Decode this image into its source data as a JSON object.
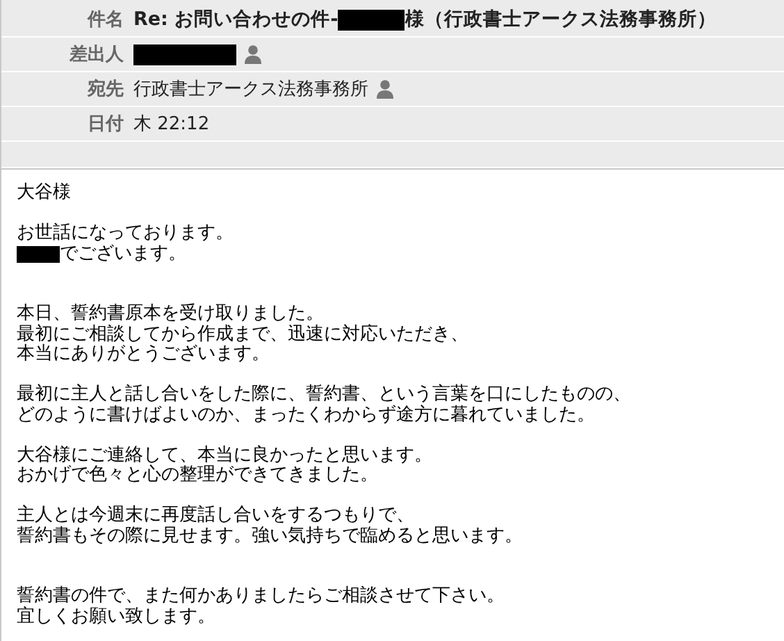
{
  "header": {
    "fields": [
      {
        "label": "件名",
        "kind": "subject",
        "parts": [
          {
            "text": "Re: お問い合わせの件-",
            "redacted_after": true
          },
          {
            "text": "様（行政書士アークス法務事務所）",
            "redacted_after": false
          }
        ],
        "contact_icon": false
      },
      {
        "label": "差出人",
        "kind": "plain",
        "parts": [
          {
            "redacted_after": true
          }
        ],
        "contact_icon": true
      },
      {
        "label": "宛先",
        "kind": "plain",
        "parts": [
          {
            "text": "行政書士アークス法務事務所",
            "redacted_after": false
          }
        ],
        "contact_icon": true
      },
      {
        "label": "日付",
        "kind": "plain",
        "parts": [
          {
            "text": "木 22:12",
            "redacted_after": false
          }
        ],
        "contact_icon": false
      }
    ]
  },
  "body": {
    "paragraphs": [
      {
        "wide_gap": false,
        "lines": [
          {
            "text": "大谷様",
            "redacted_before": false
          }
        ]
      },
      {
        "wide_gap": false,
        "lines": [
          {
            "text": "お世話になっております。",
            "redacted_before": false
          },
          {
            "text": "でございます。",
            "redacted_before": true
          }
        ]
      },
      {
        "wide_gap": true,
        "lines": [
          {
            "text": "本日、誓約書原本を受け取りました。",
            "redacted_before": false
          },
          {
            "text": "最初にご相談してから作成まで、迅速に対応いただき、",
            "redacted_before": false
          },
          {
            "text": "本当にありがとうございます。",
            "redacted_before": false
          }
        ]
      },
      {
        "wide_gap": false,
        "lines": [
          {
            "text": "最初に主人と話し合いをした際に、誓約書、という言葉を口にしたものの、",
            "redacted_before": false
          },
          {
            "text": "どのように書けばよいのか、まったくわからず途方に暮れていました。",
            "redacted_before": false
          }
        ]
      },
      {
        "wide_gap": false,
        "lines": [
          {
            "text": "大谷様にご連絡して、本当に良かったと思います。",
            "redacted_before": false
          },
          {
            "text": "おかげで色々と心の整理ができてきました。",
            "redacted_before": false
          }
        ]
      },
      {
        "wide_gap": false,
        "lines": [
          {
            "text": "主人とは今週末に再度話し合いをするつもりで、",
            "redacted_before": false
          },
          {
            "text": "誓約書もその際に見せます。強い気持ちで臨めると思います。",
            "redacted_before": false
          }
        ]
      },
      {
        "wide_gap": true,
        "lines": [
          {
            "text": "誓約書の件で、また何かありましたらご相談させて下さい。",
            "redacted_before": false
          },
          {
            "text": "宜しくお願い致します。",
            "redacted_before": false
          }
        ]
      }
    ]
  }
}
